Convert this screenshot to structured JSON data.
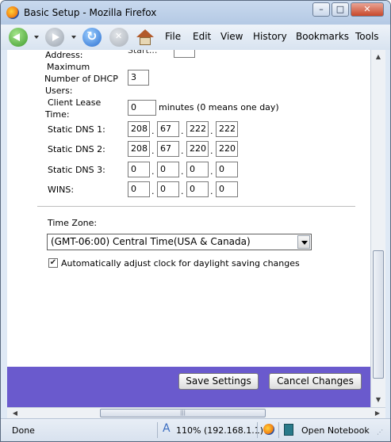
{
  "window": {
    "title": "Basic Setup - Mozilla Firefox",
    "controls": {
      "minimize": "–",
      "maximize": "□",
      "close": "✕"
    }
  },
  "menubar": [
    "File",
    "Edit",
    "View",
    "History",
    "Bookmarks",
    "Tools"
  ],
  "form": {
    "address_label": "Address:",
    "address_partial": "Start...",
    "max_dhcp_label_1": "Maximum",
    "max_dhcp_label_2": "Number of  DHCP",
    "max_dhcp_label_3": "Users:",
    "max_dhcp_value": "3",
    "lease_label_1": "Client Lease",
    "lease_label_2": "Time:",
    "lease_value": "0",
    "lease_suffix": "minutes (0 means one day)",
    "dns1_label": "Static DNS 1:",
    "dns1": [
      "208",
      "67",
      "222",
      "222"
    ],
    "dns2_label": "Static DNS 2:",
    "dns2": [
      "208",
      "67",
      "220",
      "220"
    ],
    "dns3_label": "Static DNS 3:",
    "dns3": [
      "0",
      "0",
      "0",
      "0"
    ],
    "wins_label": "WINS:",
    "wins": [
      "0",
      "0",
      "0",
      "0"
    ],
    "timezone_label": "Time Zone:",
    "timezone_value": "(GMT-06:00) Central Time(USA & Canada)",
    "dst_checked": true,
    "dst_label": "Automatically adjust clock for daylight saving changes"
  },
  "buttons": {
    "save": "Save Settings",
    "cancel": "Cancel Changes"
  },
  "statusbar": {
    "status": "Done",
    "zoom": "110% (192.168.1.1)",
    "notebook": "Open Notebook"
  },
  "colors": {
    "footer_band": "#6a5acd"
  }
}
